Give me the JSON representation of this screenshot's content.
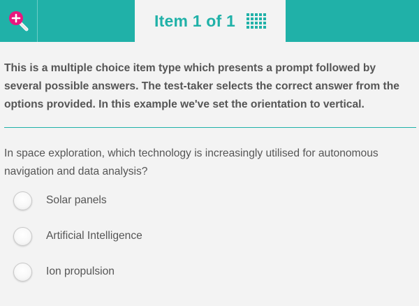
{
  "header": {
    "zoom_icon": "zoom-in-magnifier-icon",
    "counter_label": "Item 1 of 1",
    "grid_icon": "item-navigator-grid-icon",
    "accent_color": "#20b1a8",
    "zoom_badge_color": "#e8177e"
  },
  "intro": {
    "text": "This is a multiple choice item type which presents a prompt followed by several possible answers. The test-taker selects the correct answer from the options provided. In this example we've set the orientation to vertical."
  },
  "question": {
    "prompt": "In space exploration, which technology is increasingly utilised for autonomous navigation and data analysis?",
    "options": [
      {
        "label": "Solar panels",
        "selected": false
      },
      {
        "label": "Artificial Intelligence",
        "selected": false
      },
      {
        "label": "Ion propulsion",
        "selected": false
      }
    ]
  }
}
